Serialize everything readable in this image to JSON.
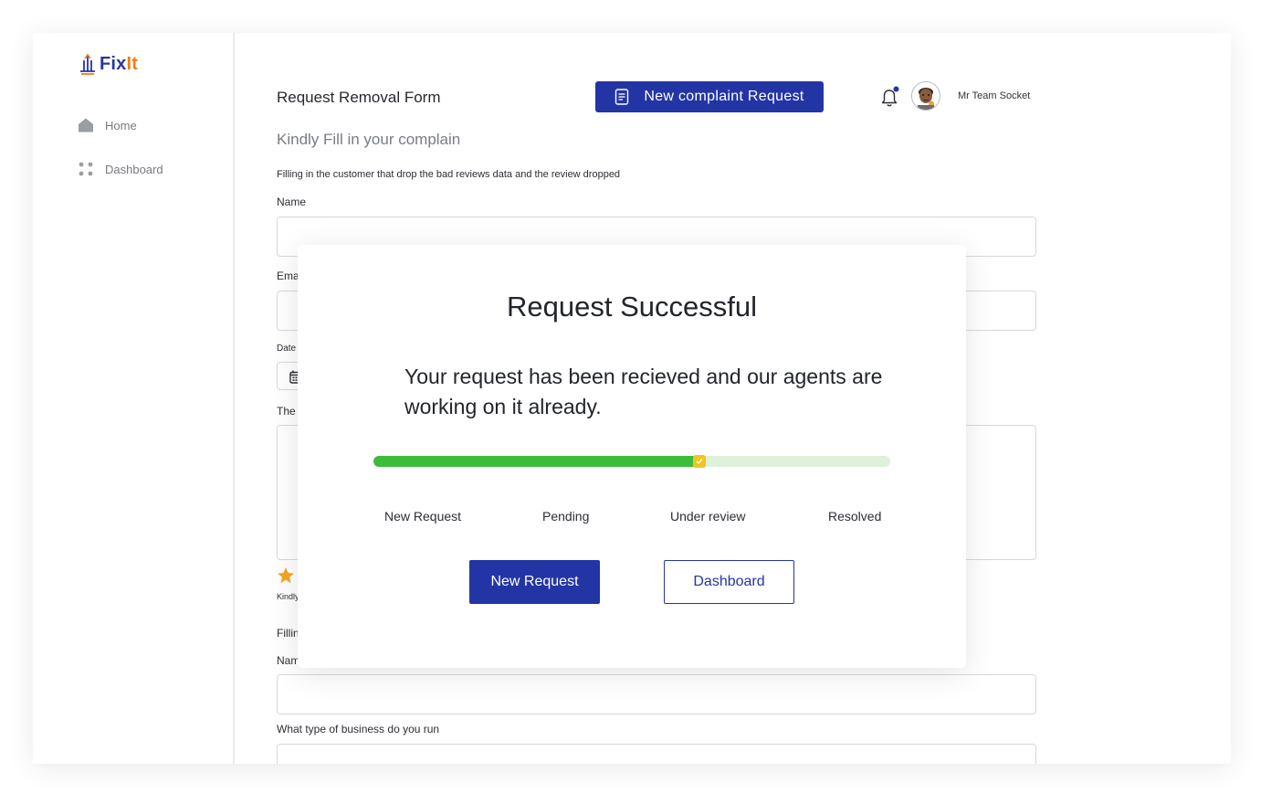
{
  "app": {
    "logo_text": "Fix",
    "logo_accent": "It"
  },
  "sidebar": {
    "items": [
      {
        "label": "Home",
        "icon": "home-icon"
      },
      {
        "label": "Dashboard",
        "icon": "dashboard-icon"
      }
    ]
  },
  "header": {
    "title": "Request Removal Form",
    "new_complaint_label": "New complaint Request",
    "user_name": "Mr Team Socket"
  },
  "form": {
    "subtitle": "Kindly Fill in your complain",
    "description": "Filling in the customer that drop the bad reviews data and the review dropped",
    "name_label": "Name",
    "email_label": "Ema",
    "date_label": "Date",
    "review_label": "The",
    "kindly_text": "Kindly",
    "filling_label": "Fillin",
    "name2_label": "Nam",
    "business_label": "What type of business do you run"
  },
  "modal": {
    "title": "Request Successful",
    "message": "Your request has been recieved and our agents are working on it already.",
    "progress": 0.63,
    "steps": [
      "New Request",
      "Pending",
      "Under review",
      "Resolved"
    ],
    "primary_button": "New Request",
    "secondary_button": "Dashboard"
  },
  "colors": {
    "brand": "#2335a4",
    "accent": "#ef7d1a",
    "progress_fill": "#3cbd3a",
    "progress_track": "#def1da",
    "progress_knob": "#f0c424",
    "star": "#f5a623"
  }
}
